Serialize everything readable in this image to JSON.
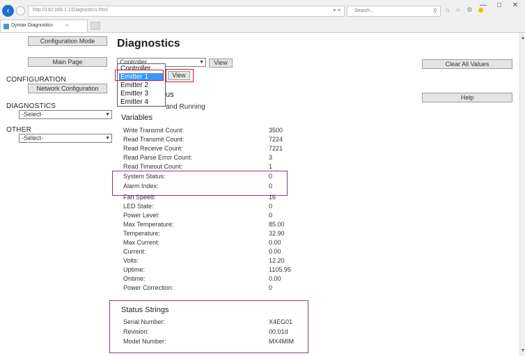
{
  "browser": {
    "address": "http://192.168.1.1/Diagnostics.html",
    "address_controls": "▾ ✕",
    "search_placeholder": "Search...",
    "search_icon": "⚲",
    "toolbar_icons": "⌂ ☆ ⚙",
    "tab_title": "Dymax Diagnostics",
    "tab_close": "×",
    "window_controls": {
      "minimize": "—",
      "maximize": "□",
      "close": "✕"
    }
  },
  "sidebar": {
    "configuration_mode_label": "Configuration Mode",
    "main_page_label": "Main Page",
    "configuration_heading": "CONFIGURATION",
    "network_configuration_label": "Network Configuration",
    "diagnostics_heading": "DIAGNOSTICS",
    "diagnostics_select_value": "-Select-",
    "other_heading": "OTHER",
    "other_select_value": "-Select-"
  },
  "main": {
    "title": "Diagnostics",
    "device_select_value": "Controller",
    "view_label": "View",
    "device_options": [
      "Controller",
      "Emitter 1",
      "Emitter 2",
      "Emitter 3",
      "Emitter 4"
    ],
    "selected_option": "Emitter 1",
    "emitter_view_label": "View",
    "clear_all_label": "Clear All Values",
    "help_label": "Help",
    "status_heading_partial": "us",
    "status_text_partial": "and Running",
    "variables_heading": "Variables",
    "variables": [
      {
        "label": "Write Transmit Count:",
        "value": "3500"
      },
      {
        "label": "Read Transmit Count:",
        "value": "7224"
      },
      {
        "label": "Read Receive Count:",
        "value": "7221"
      },
      {
        "label": "Read Parse Error Count:",
        "value": "3"
      },
      {
        "label": "Read Timeout Count:",
        "value": "1"
      },
      {
        "label": "System Status:",
        "value": "0"
      },
      {
        "label": "Alarm Index:",
        "value": "0"
      },
      {
        "label": "Fan Speed:",
        "value": "16"
      },
      {
        "label": "LED State:",
        "value": "0"
      },
      {
        "label": "Power Level:",
        "value": "0"
      },
      {
        "label": "Max Temperature:",
        "value": "85.00"
      },
      {
        "label": "Temperature:",
        "value": "32.90"
      },
      {
        "label": "Max Current:",
        "value": "0.00"
      },
      {
        "label": "Current:",
        "value": "0.00"
      },
      {
        "label": "Volts:",
        "value": "12.20"
      },
      {
        "label": "Uptime:",
        "value": "1105.95"
      },
      {
        "label": "Ontime:",
        "value": "0.00"
      },
      {
        "label": "Power Correction:",
        "value": "0"
      }
    ],
    "status_strings_heading": "Status Strings",
    "status_strings": [
      {
        "label": "Serial Number:",
        "value": "X4EG01"
      },
      {
        "label": "Revision:",
        "value": "00.01d"
      },
      {
        "label": "Model Number:",
        "value": "MX4MIM"
      }
    ]
  },
  "colors": {
    "highlight_purple": "#8a3a82",
    "highlight_red": "#d0142c",
    "selection_blue": "#3399ff"
  }
}
